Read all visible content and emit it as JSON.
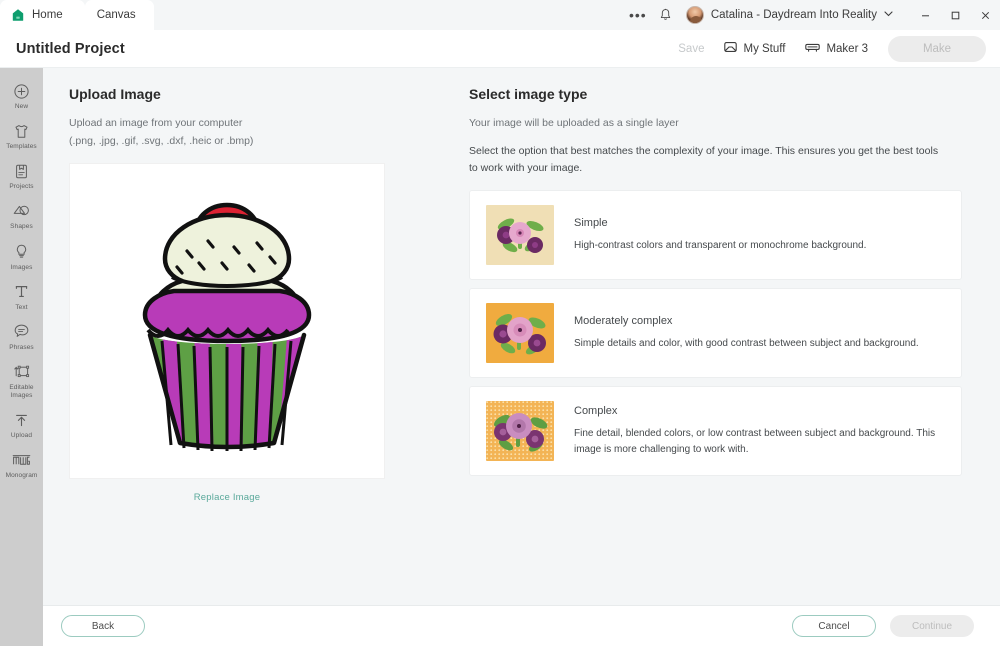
{
  "tabs": [
    {
      "label": "Home",
      "icon": "home-icon",
      "active": false
    },
    {
      "label": "Canvas",
      "icon": "",
      "active": true
    }
  ],
  "titlebar_window": {
    "more_icon": "more-options-icon",
    "bell_icon": "notifications-bell-icon",
    "avatar": "user-avatar",
    "account_name": "Catalina - Daydream Into Reality",
    "chevron_icon": "chevron-down-icon",
    "minimize_icon": "minimize-icon",
    "maximize_icon": "maximize-icon",
    "close_icon": "close-icon"
  },
  "project": {
    "title": "Untitled Project",
    "save_label": "Save",
    "my_stuff_label": "My Stuff",
    "my_stuff_icon": "inbox-icon",
    "machine_label": "Maker 3",
    "machine_icon": "machine-icon",
    "make_label": "Make"
  },
  "sidebar": {
    "items": [
      {
        "label": "New",
        "icon": "plus-circle-icon"
      },
      {
        "label": "Templates",
        "icon": "tshirt-icon"
      },
      {
        "label": "Projects",
        "icon": "projects-book-icon"
      },
      {
        "label": "Shapes",
        "icon": "shapes-icon"
      },
      {
        "label": "Images",
        "icon": "lightbulb-icon"
      },
      {
        "label": "Text",
        "icon": "text-t-icon"
      },
      {
        "label": "Phrases",
        "icon": "speech-bubble-icon"
      },
      {
        "label": "Editable Images",
        "icon": "editable-images-icon"
      },
      {
        "label": "Upload",
        "icon": "upload-arrow-icon"
      },
      {
        "label": "Monogram",
        "icon": "monogram-icon"
      }
    ]
  },
  "upload_panel": {
    "heading": "Upload Image",
    "line1": "Upload an image from your computer",
    "line2": "(.png, .jpg, .gif, .svg, .dxf, .heic or .bmp)",
    "replace_label": "Replace Image",
    "preview_alt": "cupcake-illustration"
  },
  "image_type_panel": {
    "heading": "Select image type",
    "line1": "Your image will be uploaded as a single layer",
    "line2": "Select the option that best matches the complexity of your image. This ensures you get the best tools to work with your image.",
    "options": [
      {
        "title": "Simple",
        "desc": "High-contrast colors and transparent or monochrome background.",
        "thumb_bg": "#f0dfb5",
        "thumb_name": "simple-example-thumbnail"
      },
      {
        "title": "Moderately complex",
        "desc": "Simple details and color, with good contrast between subject and background.",
        "thumb_bg": "#f0ab3f",
        "thumb_name": "moderately-complex-example-thumbnail"
      },
      {
        "title": "Complex",
        "desc": "Fine detail, blended colors, or low contrast between subject and background. This image is more challenging to work with.",
        "thumb_bg": "#f3b455",
        "thumb_name": "complex-example-thumbnail"
      }
    ]
  },
  "footer": {
    "back_label": "Back",
    "cancel_label": "Cancel",
    "continue_label": "Continue"
  },
  "colors": {
    "accent_teal": "#5aa99b",
    "home_green": "#0e9e6e",
    "rail_bg": "#cdcdcd",
    "canvas_bg": "#f4f6f7"
  }
}
